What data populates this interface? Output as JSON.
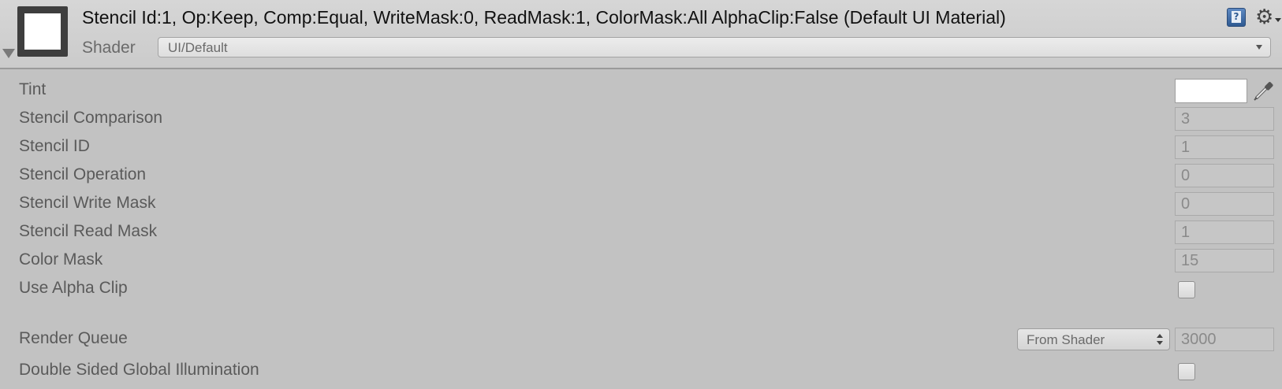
{
  "header": {
    "title": "Stencil Id:1, Op:Keep, Comp:Equal, WriteMask:0, ReadMask:1, ColorMask:All AlphaClip:False (Default UI Material)",
    "shader_label": "Shader",
    "shader_value": "UI/Default",
    "icons": [
      "help-icon",
      "gear-icon"
    ]
  },
  "properties": {
    "tint": {
      "label": "Tint",
      "color": "#ffffff"
    },
    "stencil_comparison": {
      "label": "Stencil Comparison",
      "value": "3"
    },
    "stencil_id": {
      "label": "Stencil ID",
      "value": "1"
    },
    "stencil_operation": {
      "label": "Stencil Operation",
      "value": "0"
    },
    "stencil_write_mask": {
      "label": "Stencil Write Mask",
      "value": "0"
    },
    "stencil_read_mask": {
      "label": "Stencil Read Mask",
      "value": "1"
    },
    "color_mask": {
      "label": "Color Mask",
      "value": "15"
    },
    "use_alpha_clip": {
      "label": "Use Alpha Clip",
      "checked": false
    }
  },
  "render_queue": {
    "label": "Render Queue",
    "mode": "From Shader",
    "value": "3000"
  },
  "double_sided_gi": {
    "label": "Double Sided Global Illumination",
    "checked": false
  }
}
